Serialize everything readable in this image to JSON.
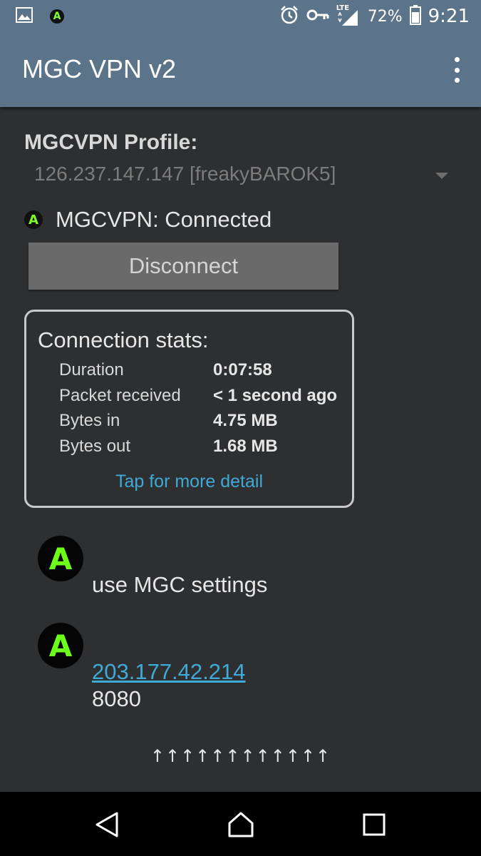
{
  "status_bar": {
    "network": "LTE",
    "battery": "72%",
    "time": "9:21",
    "app_badge": "A"
  },
  "app_bar": {
    "title": "MGC VPN v2"
  },
  "profile": {
    "label": "MGCVPN Profile:",
    "selected": "126.237.147.147 [freakyBAROK5]"
  },
  "connection": {
    "status_text": "MGCVPN: Connected",
    "icon_letter": "A",
    "button_label": "Disconnect"
  },
  "stats": {
    "title": "Connection stats:",
    "rows": [
      {
        "label": "Duration",
        "value": "0:07:58"
      },
      {
        "label": "Packet received",
        "value": "< 1 second ago"
      },
      {
        "label": "Bytes in",
        "value": "4.75 MB"
      },
      {
        "label": "Bytes out",
        "value": "1.68 MB"
      }
    ],
    "link": "Tap for more detail"
  },
  "messages": [
    {
      "avatar": "A",
      "text": "use MGC settings"
    },
    {
      "avatar": "A",
      "link": "203.177.42.214",
      "text": "8080"
    }
  ],
  "footer_arrows": "↑↑↑↑↑↑↑↑↑↑↑↑",
  "colors": {
    "bar": "#5b7489",
    "background": "#2e2f31",
    "accent_link": "#3fa9d8",
    "icon_green": "#6cff1a"
  }
}
